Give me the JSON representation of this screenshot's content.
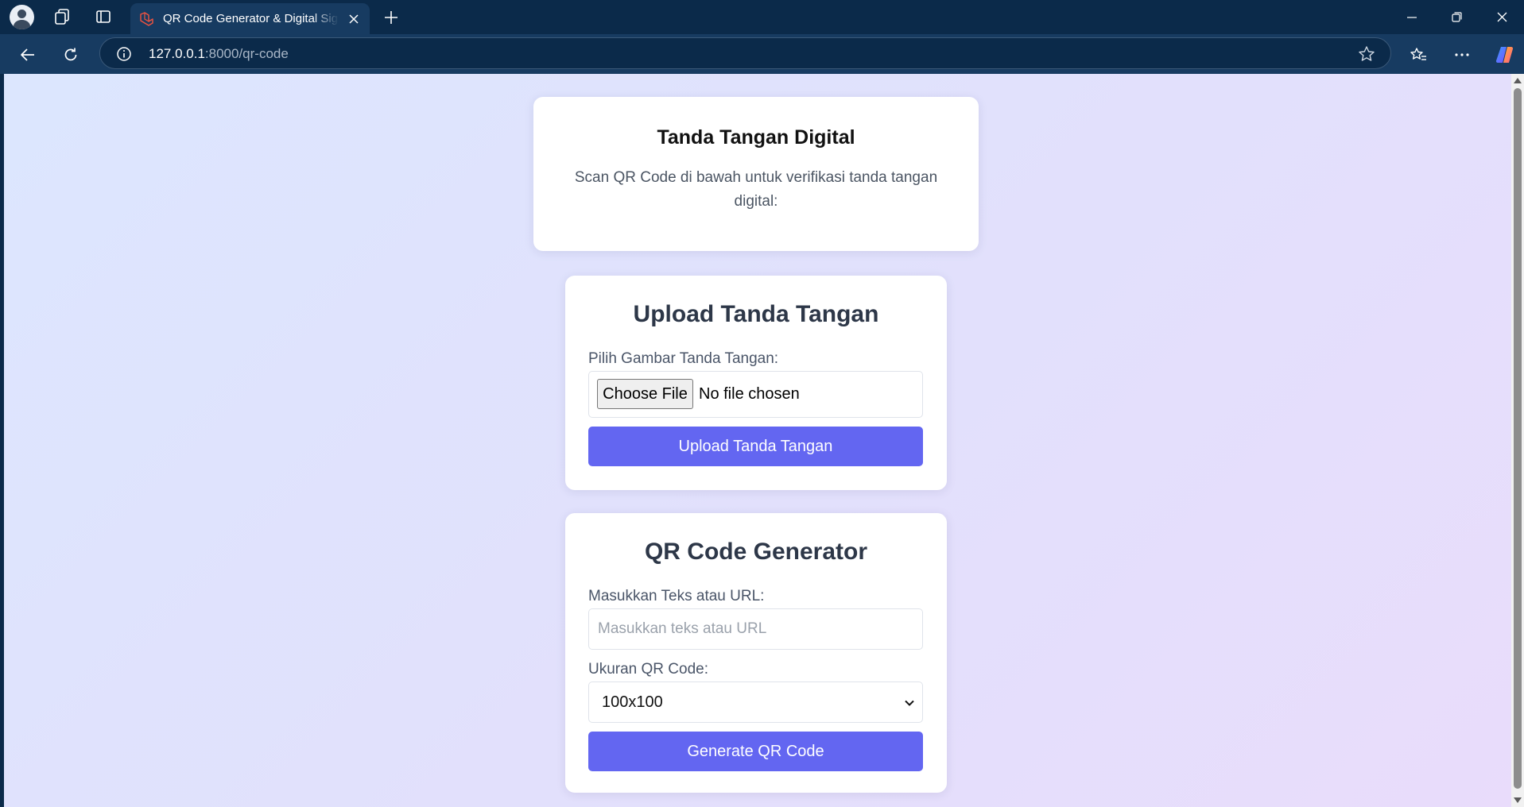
{
  "browser": {
    "tab_title": "QR Code Generator & Digital Signature",
    "url_host": "127.0.0.1",
    "url_path": ":8000/qr-code"
  },
  "page": {
    "signature_card": {
      "title": "Tanda Tangan Digital",
      "description": "Scan QR Code di bawah untuk verifikasi tanda tangan digital:"
    },
    "upload_card": {
      "title": "Upload Tanda Tangan",
      "file_label": "Pilih Gambar Tanda Tangan:",
      "choose_button": "Choose File",
      "file_status": "No file chosen",
      "submit_button": "Upload Tanda Tangan"
    },
    "qr_card": {
      "title": "QR Code Generator",
      "text_label": "Masukkan Teks atau URL:",
      "text_placeholder": "Masukkan teks atau URL",
      "size_label": "Ukuran QR Code:",
      "size_selected": "100x100",
      "submit_button": "Generate QR Code"
    }
  },
  "colors": {
    "primary_button": "#6366f1",
    "browser_chrome": "#0b2a4a",
    "browser_toolbar": "#173b61"
  }
}
